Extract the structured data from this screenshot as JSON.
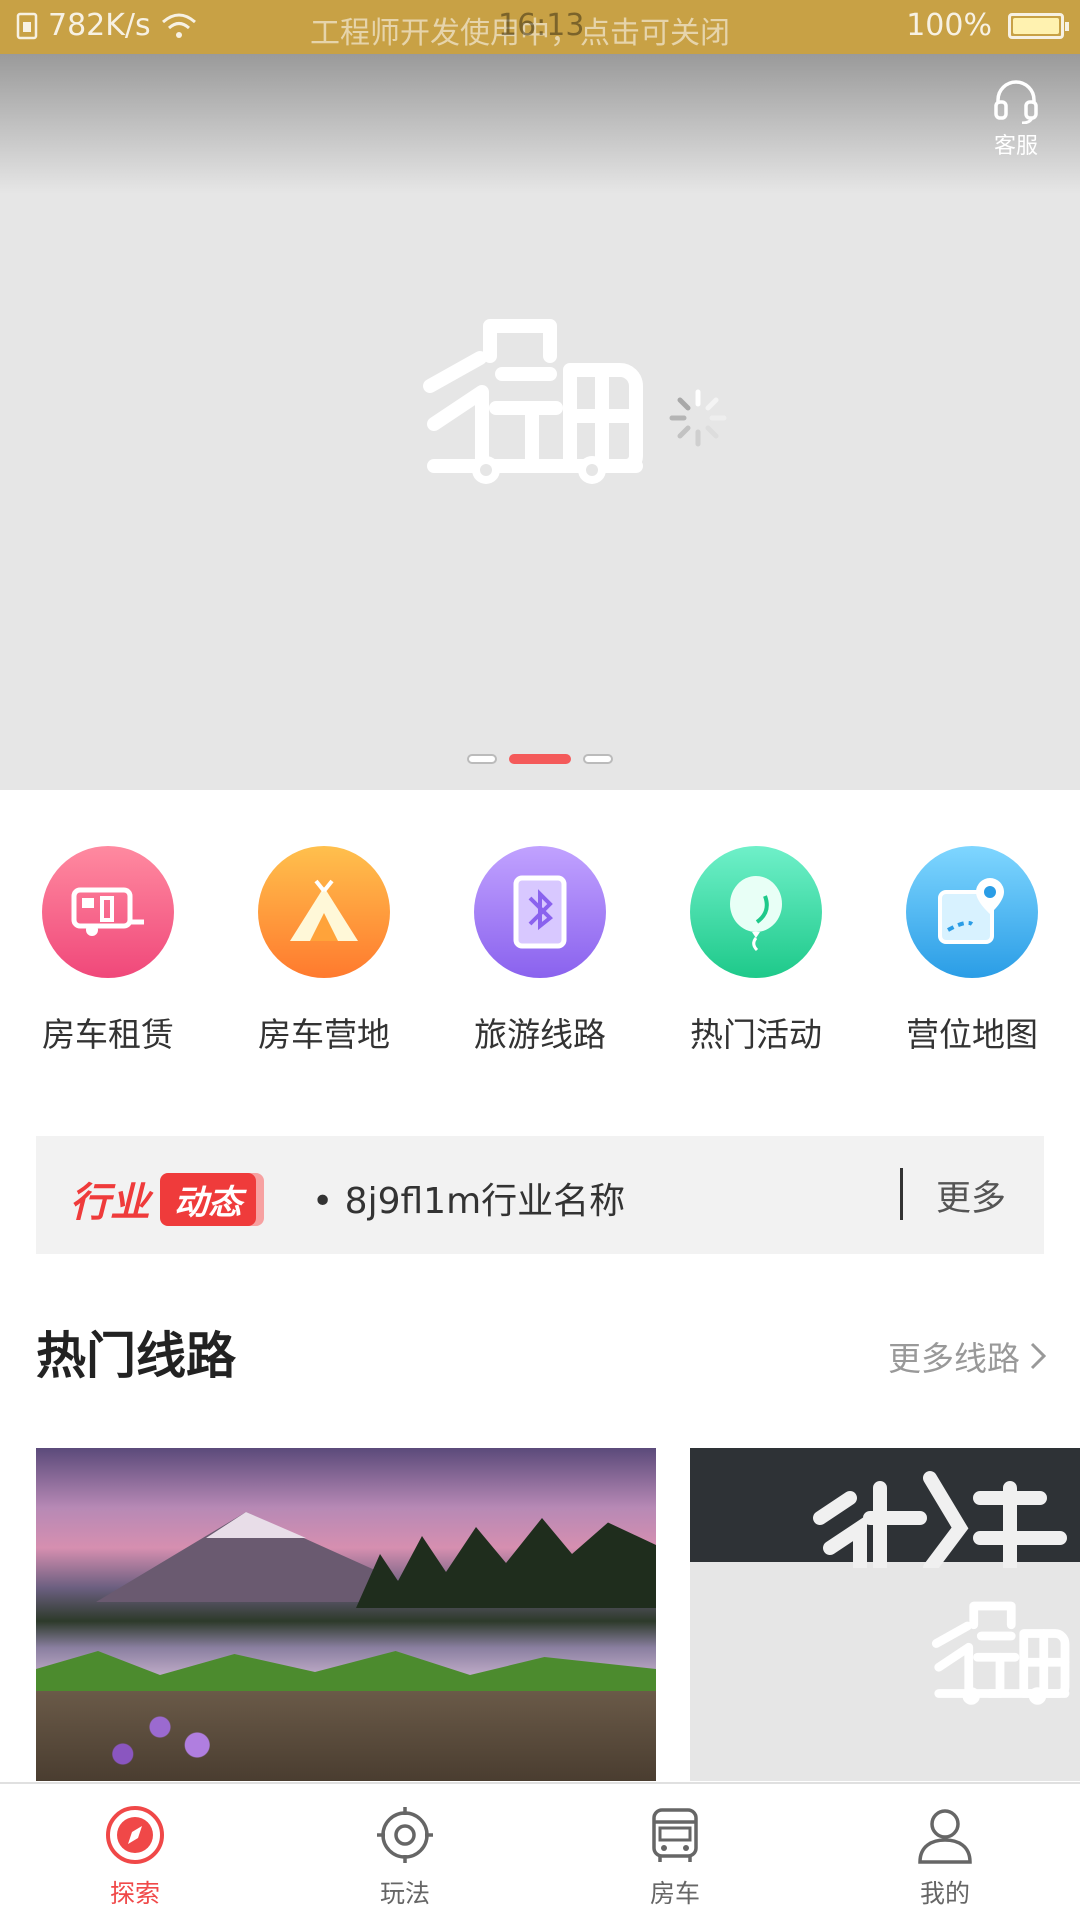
{
  "status_bar": {
    "net_speed": "782K/s",
    "notice": "工程师开发使用中，点击可关闭",
    "time": "16:13",
    "battery": "100%",
    "battery_level": 1.0
  },
  "banner": {
    "customer_service_label": "客服",
    "logo_icon": "xingli-luggage-logo",
    "loading_icon": "loading-spinner",
    "slide_count": 3,
    "active_slide": 1
  },
  "categories": [
    {
      "label": "房车租赁",
      "icon": "rv-trailer-icon",
      "color_from": "#ff8aa0",
      "color_to": "#f0487a"
    },
    {
      "label": "房车营地",
      "icon": "tent-icon",
      "color_from": "#ffc04d",
      "color_to": "#ff7a2e"
    },
    {
      "label": "旅游线路",
      "icon": "route-card-icon",
      "color_from": "#c1a2ff",
      "color_to": "#8a62ee"
    },
    {
      "label": "热门活动",
      "icon": "balloon-icon",
      "color_from": "#6ff0c9",
      "color_to": "#1ec98a"
    },
    {
      "label": "营位地图",
      "icon": "map-pin-icon",
      "color_from": "#7fd6ff",
      "color_to": "#2a9de6"
    }
  ],
  "news": {
    "brand_part1": "行业",
    "brand_part2": "动态",
    "text": "• 8j9fl1m行业名称",
    "more": "更多"
  },
  "hot_routes": {
    "title": "热门线路",
    "more": "更多线路"
  },
  "tabbar": {
    "items": [
      {
        "label": "探索",
        "icon": "compass-icon",
        "active": true
      },
      {
        "label": "玩法",
        "icon": "target-icon",
        "active": false
      },
      {
        "label": "房车",
        "icon": "bus-icon",
        "active": false
      },
      {
        "label": "我的",
        "icon": "user-icon",
        "active": false
      }
    ]
  },
  "colors": {
    "status_bar": "#c8a145",
    "accent": "#f04848"
  }
}
